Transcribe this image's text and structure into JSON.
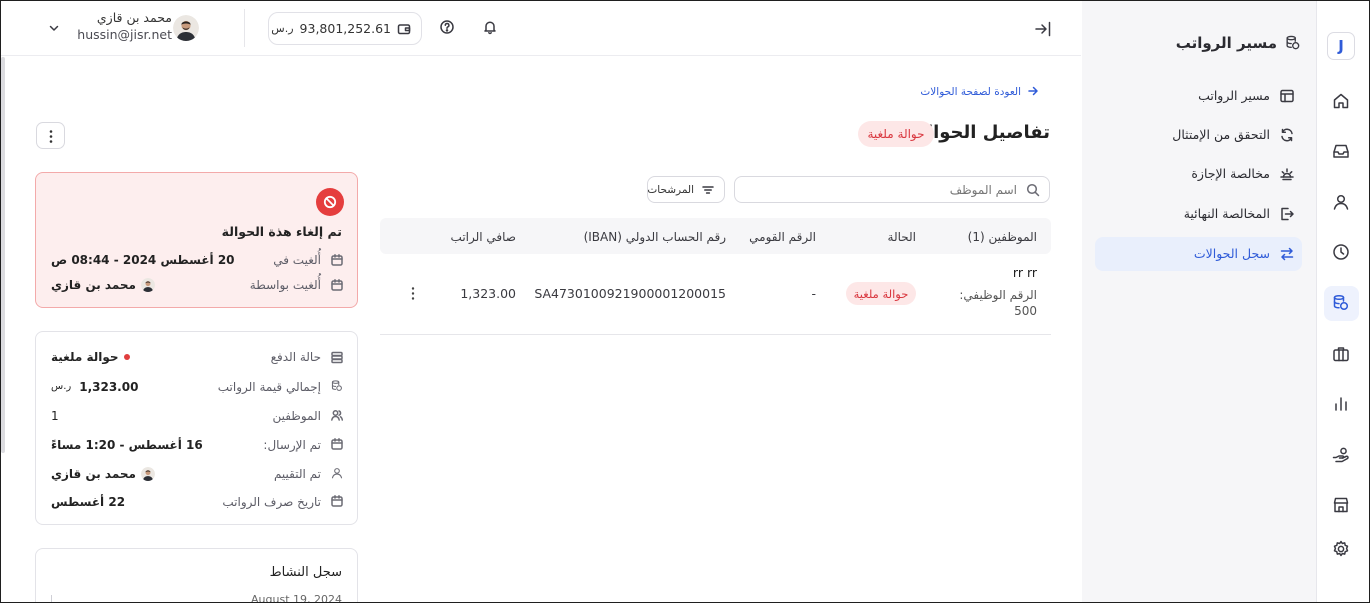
{
  "brand": {
    "logo_letter": "J"
  },
  "rail": {
    "items": [
      {
        "icon": "home-icon",
        "active": false
      },
      {
        "icon": "inbox-icon",
        "active": false
      },
      {
        "icon": "user-icon",
        "active": false
      },
      {
        "icon": "clock-icon",
        "active": false
      },
      {
        "icon": "payroll-icon",
        "active": true
      },
      {
        "icon": "briefcase-icon",
        "active": false
      },
      {
        "icon": "bar-chart-icon",
        "active": false
      },
      {
        "icon": "hand-coins-icon",
        "active": false
      },
      {
        "icon": "store-icon",
        "active": false
      },
      {
        "icon": "gear-icon",
        "active": false
      }
    ]
  },
  "sidebar": {
    "title": "مسير الرواتب",
    "title_icon": "payroll-icon",
    "items": [
      {
        "label": "مسير الرواتب",
        "icon": "table-icon",
        "active": false
      },
      {
        "label": "التحقق من الإمتثال",
        "icon": "refresh-icon",
        "active": false
      },
      {
        "label": "مخالصة الإجازة",
        "icon": "sunset-icon",
        "active": false
      },
      {
        "label": "المخالصة النهائية",
        "icon": "exit-icon",
        "active": false
      },
      {
        "label": "سجل الحوالات",
        "icon": "transfer-arrows-icon",
        "active": true
      }
    ]
  },
  "header": {
    "user": {
      "name": "محمد بن قازي",
      "email": "hussin@jisr.net"
    },
    "balance": {
      "amount": "93,801,252.61",
      "currency": "ر.س"
    }
  },
  "page": {
    "back_link": "العودة لصفحة الحوالات",
    "title": "تفاصيل الحوالة",
    "status_badge": "حوالة ملغية"
  },
  "toolbar": {
    "search_placeholder": "اسم الموظف",
    "filters_label": "المرشحات"
  },
  "table": {
    "columns": [
      "الموظفين (1)",
      "الحالة",
      "الرقم القومي",
      "رقم الحساب الدولي (IBAN)",
      "صافي الراتب"
    ],
    "rows": [
      {
        "employee_name": "rr rr",
        "employee_id_label": "الرقم الوظيفي:",
        "employee_id": "500",
        "status": "حوالة ملغية",
        "national_id": "-",
        "iban": "SA4730100921900001200015",
        "net_salary": "1,323.00"
      }
    ]
  },
  "cancellation": {
    "heading": "تم إلغاء هذة الحوالة",
    "fields": [
      {
        "label": "أُلغيت في",
        "value": "20 أغسطس 2024 - 08:44 ص"
      },
      {
        "label": "أُلغيت بواسطة",
        "value": "محمد بن قازي"
      }
    ]
  },
  "summary": {
    "fields": [
      {
        "label": "حالة الدفع",
        "value": "حوالة ملغية"
      },
      {
        "label": "إجمالي قيمة الرواتب",
        "value": "1,323.00",
        "currency": "ر.س"
      },
      {
        "label": "الموظفين",
        "value": "1"
      },
      {
        "label": "تم الإرسال:",
        "value": "16 أغسطس - 1:20 مساءً"
      },
      {
        "label": "تم التقييم",
        "value": "محمد بن قازي"
      },
      {
        "label": "تاريخ صرف الرواتب",
        "value": "22 أغسطس"
      }
    ]
  },
  "activity": {
    "title": "سجل النشاط",
    "entries": [
      {
        "date": "August 19, 2024"
      }
    ]
  },
  "colors": {
    "accent": "#2f5bd8",
    "danger": "#e03e3e",
    "danger_card_bg": "#fdeeee",
    "badge_bg": "#fde7e7",
    "active_nav_bg": "#e9effc",
    "sidebar_bg": "#f6f6f8"
  }
}
